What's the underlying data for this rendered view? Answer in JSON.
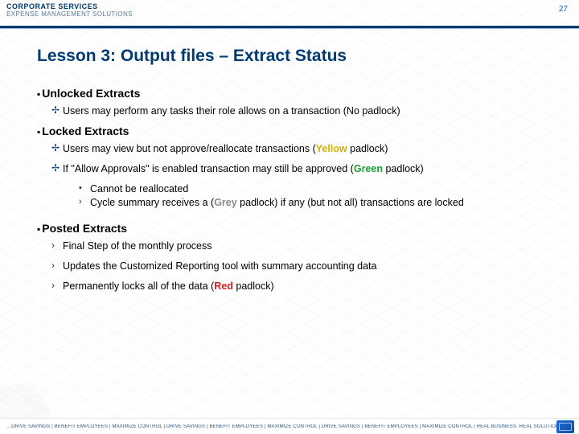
{
  "header": {
    "brand_top": "CORPORATE SERVICES",
    "brand_sub": "EXPENSE MANAGEMENT SOLUTIONS",
    "page_number": "27"
  },
  "title": "Lesson 3: Output files – Extract Status",
  "sections": {
    "unlocked": {
      "heading": "Unlocked Extracts",
      "item0": "Users may perform any tasks their role allows on a transaction (No padlock)"
    },
    "locked": {
      "heading": "Locked Extracts",
      "item0_pre": "Users may view but not approve/reallocate transactions (",
      "item0_color": "Yellow",
      "item0_post": " padlock)",
      "item1_pre": "If \"Allow Approvals\" is enabled transaction may still be approved (",
      "item1_color": "Green",
      "item1_post": " padlock)",
      "sub0": "Cannot be reallocated",
      "sub1_pre": "Cycle summary receives a (",
      "sub1_color": "Grey",
      "sub1_post": " padlock) if any (but not all) transactions are locked"
    },
    "posted": {
      "heading": "Posted Extracts",
      "item0": "Final Step of the monthly process",
      "item1": "Updates the Customized Reporting tool with summary accounting data",
      "item2_pre": "Permanently locks all of the data (",
      "item2_color": "Red",
      "item2_post": " padlock)"
    }
  },
  "footer": {
    "tagline": "…DRIVE SAVINGS | BENEFIT EMPLOYEES | MAXIMIZE CONTROL | DRIVE SAVINGS | BENEFIT EMPLOYEES | MAXIMIZE CONTROL | DRIVE SAVINGS | BENEFIT EMPLOYEES | MAXIMIZE CONTROL | REAL BUSINESS. REAL SOLUTIONS.™"
  }
}
